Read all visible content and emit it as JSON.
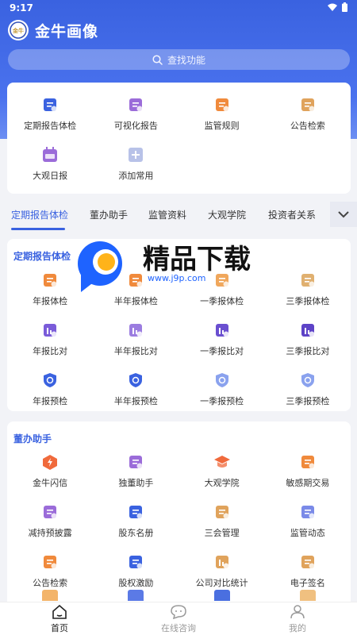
{
  "status_bar": {
    "time": "9:17"
  },
  "app": {
    "title": "金牛画像",
    "logo_text": "金牛"
  },
  "search": {
    "placeholder": "查找功能"
  },
  "quick_access": [
    {
      "label": "定期报告体检",
      "icon": "report-check-icon",
      "color": "#3a62e0"
    },
    {
      "label": "可视化报告",
      "icon": "chart-report-icon",
      "color": "#9b6cd9"
    },
    {
      "label": "监管规则",
      "icon": "rules-star-icon",
      "color": "#f08a3c"
    },
    {
      "label": "公告检索",
      "icon": "announcement-search-icon",
      "color": "#e0a35c"
    },
    {
      "label": "大观日报",
      "icon": "daily-calendar-icon",
      "color": "#9b6cd9"
    },
    {
      "label": "添加常用",
      "icon": "add-icon",
      "color": "#b8c2e8"
    }
  ],
  "tabs": {
    "items": [
      "定期报告体检",
      "董办助手",
      "监管资料",
      "大观学院",
      "投资者关系"
    ],
    "active": "定期报告体检"
  },
  "report_section": {
    "title": "定期报告体检",
    "items": [
      {
        "label": "年报体检",
        "icon": "annual-check-icon",
        "color": "#f08a3c"
      },
      {
        "label": "半年报体检",
        "icon": "halfyear-check-icon",
        "color": "#f08a3c"
      },
      {
        "label": "一季报体检",
        "icon": "q1-check-icon",
        "color": "#f0a75c"
      },
      {
        "label": "三季报体检",
        "icon": "q3-check-icon",
        "color": "#e0b070"
      },
      {
        "label": "年报比对",
        "icon": "annual-compare-icon",
        "color": "#7a5cd9"
      },
      {
        "label": "半年报比对",
        "icon": "halfyear-compare-icon",
        "color": "#9b7ce0"
      },
      {
        "label": "一季报比对",
        "icon": "q1-compare-icon",
        "color": "#6a4fd0"
      },
      {
        "label": "三季报比对",
        "icon": "q3-compare-icon",
        "color": "#5d43c7"
      },
      {
        "label": "年报预检",
        "icon": "annual-precheck-icon",
        "color": "#3a62e0"
      },
      {
        "label": "半年报预检",
        "icon": "halfyear-precheck-icon",
        "color": "#3a62e0"
      },
      {
        "label": "一季报预检",
        "icon": "q1-precheck-icon",
        "color": "#8aa2ee"
      },
      {
        "label": "三季报预检",
        "icon": "q3-precheck-icon",
        "color": "#8aa2ee"
      }
    ]
  },
  "board_section": {
    "title": "董办助手",
    "items": [
      {
        "label": "金牛闪信",
        "icon": "flash-message-icon",
        "color": "#f06a3c"
      },
      {
        "label": "独董助手",
        "icon": "director-assistant-icon",
        "color": "#9b6cd9"
      },
      {
        "label": "大观学院",
        "icon": "graduation-cap-icon",
        "color": "#f06a3c"
      },
      {
        "label": "敏感期交易",
        "icon": "sensitive-trade-icon",
        "color": "#f08a3c"
      },
      {
        "label": "减持预披露",
        "icon": "reduction-disclosure-icon",
        "color": "#9b6cd9"
      },
      {
        "label": "股东名册",
        "icon": "shareholder-register-icon",
        "color": "#3a62e0"
      },
      {
        "label": "三会管理",
        "icon": "meeting-management-icon",
        "color": "#e0a35c"
      },
      {
        "label": "监管动态",
        "icon": "regulatory-news-icon",
        "color": "#7a8ae8"
      },
      {
        "label": "公告检索",
        "icon": "announcement-search-icon",
        "color": "#f08a3c"
      },
      {
        "label": "股权激励",
        "icon": "equity-incentive-icon",
        "color": "#3a62e0"
      },
      {
        "label": "公司对比统计",
        "icon": "company-compare-icon",
        "color": "#e0a35c"
      },
      {
        "label": "电子签名",
        "icon": "e-signature-icon",
        "color": "#e0a35c"
      }
    ]
  },
  "bottom_nav": [
    {
      "label": "首页",
      "icon": "home-icon",
      "active": true
    },
    {
      "label": "在线咨询",
      "icon": "chat-icon",
      "active": false
    },
    {
      "label": "我的",
      "icon": "profile-icon",
      "active": false
    }
  ],
  "watermark": {
    "brand": "精品下载",
    "url": "www.j9p.com"
  }
}
